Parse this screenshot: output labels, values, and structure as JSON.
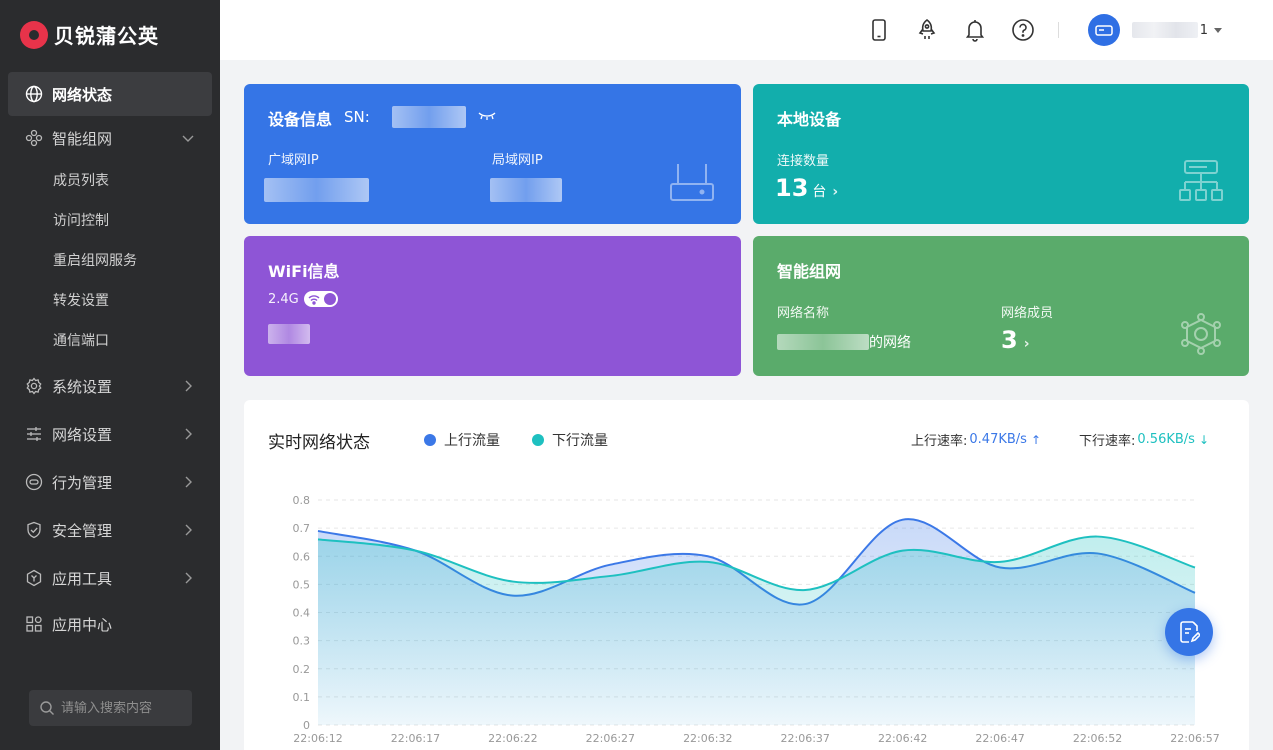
{
  "brand": {
    "name": "贝锐蒲公英"
  },
  "sidebar": {
    "items": [
      {
        "label": "网络状态",
        "icon": "globe-icon"
      },
      {
        "label": "智能组网",
        "icon": "cluster-icon"
      },
      {
        "label": "系统设置",
        "icon": "gear-icon"
      },
      {
        "label": "网络设置",
        "icon": "sliders-icon"
      },
      {
        "label": "行为管理",
        "icon": "behavior-icon"
      },
      {
        "label": "安全管理",
        "icon": "shield-icon"
      },
      {
        "label": "应用工具",
        "icon": "tools-icon"
      },
      {
        "label": "应用中心",
        "icon": "apps-grid-icon"
      }
    ],
    "subitems": [
      "成员列表",
      "访问控制",
      "重启组网服务",
      "转发设置",
      "通信端口"
    ],
    "search_placeholder": "请输入搜索内容"
  },
  "header": {
    "icons": [
      "phone-icon",
      "rocket-icon",
      "bell-icon",
      "help-icon"
    ],
    "username_suffix": "1"
  },
  "cards": {
    "device": {
      "title": "设备信息",
      "sn_label": "SN:",
      "wan_label": "广域网IP",
      "lan_label": "局域网IP"
    },
    "local": {
      "title": "本地设备",
      "conn_label": "连接数量",
      "count": "13",
      "unit": "台"
    },
    "wifi": {
      "title": "WiFi信息",
      "band": "2.4G"
    },
    "smartnet": {
      "title": "智能组网",
      "name_label": "网络名称",
      "name_suffix": "的网络",
      "member_label": "网络成员",
      "member_count": "3"
    }
  },
  "panel": {
    "title": "实时网络状态",
    "legend_up": "上行流量",
    "legend_down": "下行流量",
    "up_rate_label": "上行速率:",
    "up_rate_value": "0.47KB/s",
    "down_rate_label": "下行速率:",
    "down_rate_value": "0.56KB/s"
  },
  "colors": {
    "up": "#3b78e7",
    "down": "#1ec0c0"
  },
  "chart_data": {
    "type": "area",
    "title": "实时网络状态",
    "x": [
      "22:06:12",
      "22:06:17",
      "22:06:22",
      "22:06:27",
      "22:06:32",
      "22:06:37",
      "22:06:42",
      "22:06:47",
      "22:06:52",
      "22:06:57"
    ],
    "ylim": [
      0,
      0.8
    ],
    "yticks": [
      0,
      0.1,
      0.2,
      0.3,
      0.4,
      0.5,
      0.6,
      0.7,
      0.8
    ],
    "grid": true,
    "legend": "top",
    "series": [
      {
        "name": "上行流量",
        "values": [
          0.69,
          0.62,
          0.46,
          0.57,
          0.6,
          0.43,
          0.73,
          0.56,
          0.61,
          0.47
        ]
      },
      {
        "name": "下行流量",
        "values": [
          0.66,
          0.62,
          0.51,
          0.53,
          0.58,
          0.48,
          0.62,
          0.58,
          0.67,
          0.56
        ]
      }
    ]
  }
}
